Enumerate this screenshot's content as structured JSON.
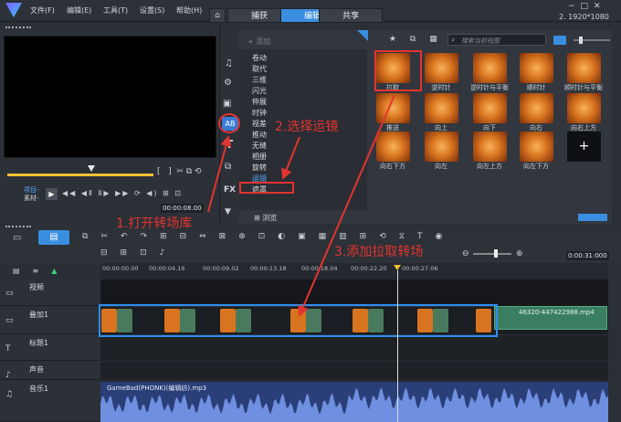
{
  "app": {
    "menus": [
      "文件(F)",
      "编辑(E)",
      "工具(T)",
      "设置(S)",
      "帮助(H)"
    ],
    "tabs": [
      "捕获",
      "编辑",
      "共享"
    ],
    "active_tab": "编辑",
    "resolution": "2. 1920*1080"
  },
  "player": {
    "project_label": "项目-",
    "clip_label": "素材-",
    "timecode": "00:00:08.00"
  },
  "library": {
    "add_label": "添加",
    "search_placeholder": "搜索当前视图",
    "categories": [
      "卷动",
      "取代",
      "三维",
      "闪光",
      "伸展",
      "时钟",
      "视差",
      "推动",
      "无缝",
      "相册",
      "旋转",
      "运镜",
      "遮罩"
    ],
    "selected_category": "运镜",
    "browse_label": "浏览",
    "transitions": [
      "拉取",
      "逆时针",
      "逆时针与平衡",
      "顺时针",
      "顺时针与平衡",
      "推送",
      "向上",
      "向下",
      "向右",
      "向右上方",
      "向右下方",
      "向左",
      "向左上方",
      "向左下方"
    ]
  },
  "timeline": {
    "timecodes": [
      "00:00:00.00",
      "00:00:04.16",
      "00:00:09.02",
      "00:00:13.18",
      "00:00:18.04",
      "00:00:22.20",
      "00:00:27.06"
    ],
    "zoom_timecode": "0:00:31:000",
    "tracks": [
      "视频",
      "叠加1",
      "标题1",
      "声音",
      "音乐1"
    ],
    "overlay_clip_name": "46320-447422988.mp4",
    "music_clip_name": "GameBad(PHONK)(编辑纺).mp3"
  },
  "annotations": {
    "step1": "1.打开转场库",
    "step2": "2.选择运镜",
    "step3": "3.添加拉取转场",
    "color": "#e3342f"
  }
}
